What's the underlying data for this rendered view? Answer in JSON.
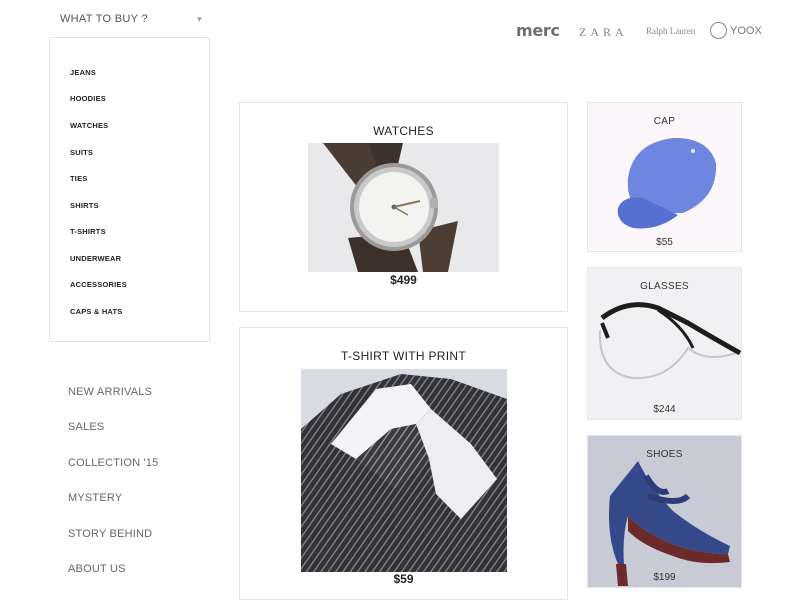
{
  "dropdown": {
    "label": "WHAT TO BUY ?",
    "icon": "chevron-down-icon"
  },
  "brands": {
    "merc": "merc",
    "zara": "ZARA",
    "ralph": "Ralph Lauren",
    "yoox": "YOOX"
  },
  "categories": [
    "JEANS",
    "HOODIES",
    "WATCHES",
    "SUITS",
    "TIES",
    "SHIRTS",
    "T-SHIRTS",
    "UNDERWEAR",
    "ACCESSORIES",
    "CAPS & HATS"
  ],
  "side_nav": [
    "NEW ARRIVALS",
    "SALES",
    "COLLECTION '15",
    "MYSTERY",
    "STORY BEHIND",
    "ABOUT US"
  ],
  "products": {
    "watches": {
      "title": "WATCHES",
      "price": "$499"
    },
    "tshirt": {
      "title": "T-SHIRT WITH PRINT",
      "price": "$59"
    },
    "cap": {
      "title": "CAP",
      "price": "$55"
    },
    "glasses": {
      "title": "GLASSES",
      "price": "$244"
    },
    "shoes": {
      "title": "SHOES",
      "price": "$199"
    }
  },
  "colors": {
    "cap_blue": "#6d86e0",
    "shoe_blue": "#34488a",
    "card_border": "#e6e6e6"
  }
}
